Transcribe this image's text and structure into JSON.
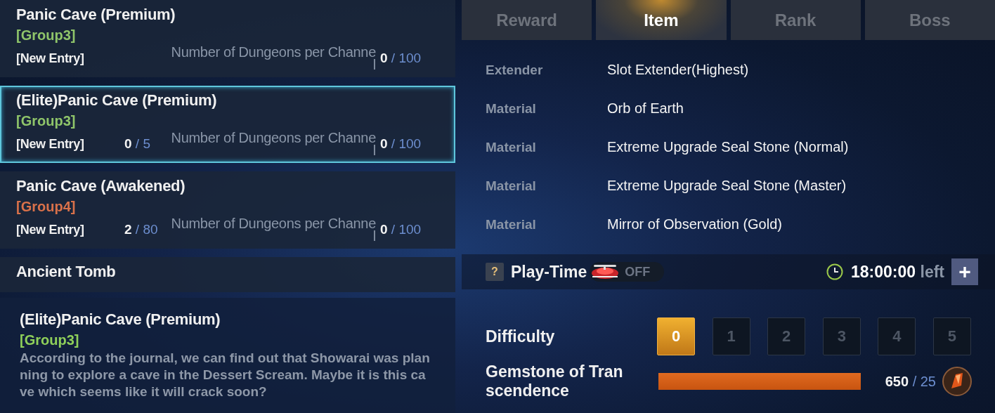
{
  "dungeons": [
    {
      "title": "Panic Cave (Premium)",
      "group": "[Group3]",
      "color": "#8fc56a",
      "entry": "[New Entry]",
      "quota_label": "Number of Dungeons per Channel",
      "quota_used": "0",
      "quota_max": "/ 100",
      "selected": false
    },
    {
      "title": "(Elite)Panic Cave (Premium)",
      "group": "[Group3]",
      "color": "#8fc56a",
      "entry": "[New Entry]",
      "count_used": "0",
      "count_max": "/ 5",
      "quota_label": "Number of Dungeons per Channel",
      "quota_used": "0",
      "quota_max": "/ 100",
      "selected": true
    },
    {
      "title": "Panic Cave (Awakened)",
      "group": "[Group4]",
      "color": "#d9714a",
      "entry": "[New Entry]",
      "count_used": "2",
      "count_max": "/ 80",
      "quota_label": "Number of Dungeons per Channel",
      "quota_used": "0",
      "quota_max": "/ 100",
      "selected": false
    },
    {
      "title": "Ancient Tomb",
      "selected": false
    }
  ],
  "detail": {
    "title": "(Elite)Panic Cave (Premium)",
    "group": "[Group3]",
    "description": "According to the journal, we can find out that Showarai was planning to explore a cave in the Dessert Scream. Maybe it is this cave which seems like it will crack soon?"
  },
  "tabs": [
    {
      "label": "Reward",
      "selected": false
    },
    {
      "label": "Item",
      "selected": true
    },
    {
      "label": "Rank",
      "selected": false
    },
    {
      "label": "Boss",
      "selected": false
    }
  ],
  "items": [
    {
      "type": "Extender",
      "name": "Slot Extender(Highest)"
    },
    {
      "type": "Material",
      "name": "Orb of Earth"
    },
    {
      "type": "Material",
      "name": "Extreme Upgrade Seal Stone (Normal)"
    },
    {
      "type": "Material",
      "name": "Extreme Upgrade Seal Stone (Master)"
    },
    {
      "type": "Material",
      "name": "Mirror of Observation (Gold)"
    }
  ],
  "play_time": {
    "help": "?",
    "label": "Play-Time",
    "toggle": {
      "label": "OFF",
      "on": false
    },
    "time": "18:00:00",
    "suffix": "left",
    "add": "+"
  },
  "difficulty": {
    "label": "Difficulty",
    "levels": [
      {
        "label": "0",
        "selected": true
      },
      {
        "label": "1",
        "selected": false
      },
      {
        "label": "2",
        "selected": false
      },
      {
        "label": "3",
        "selected": false
      },
      {
        "label": "4",
        "selected": false
      },
      {
        "label": "5",
        "selected": false
      }
    ]
  },
  "gemstone": {
    "label": "Gemstone of Transcendence",
    "level": 1,
    "owned": "650",
    "required": "/ 25"
  }
}
